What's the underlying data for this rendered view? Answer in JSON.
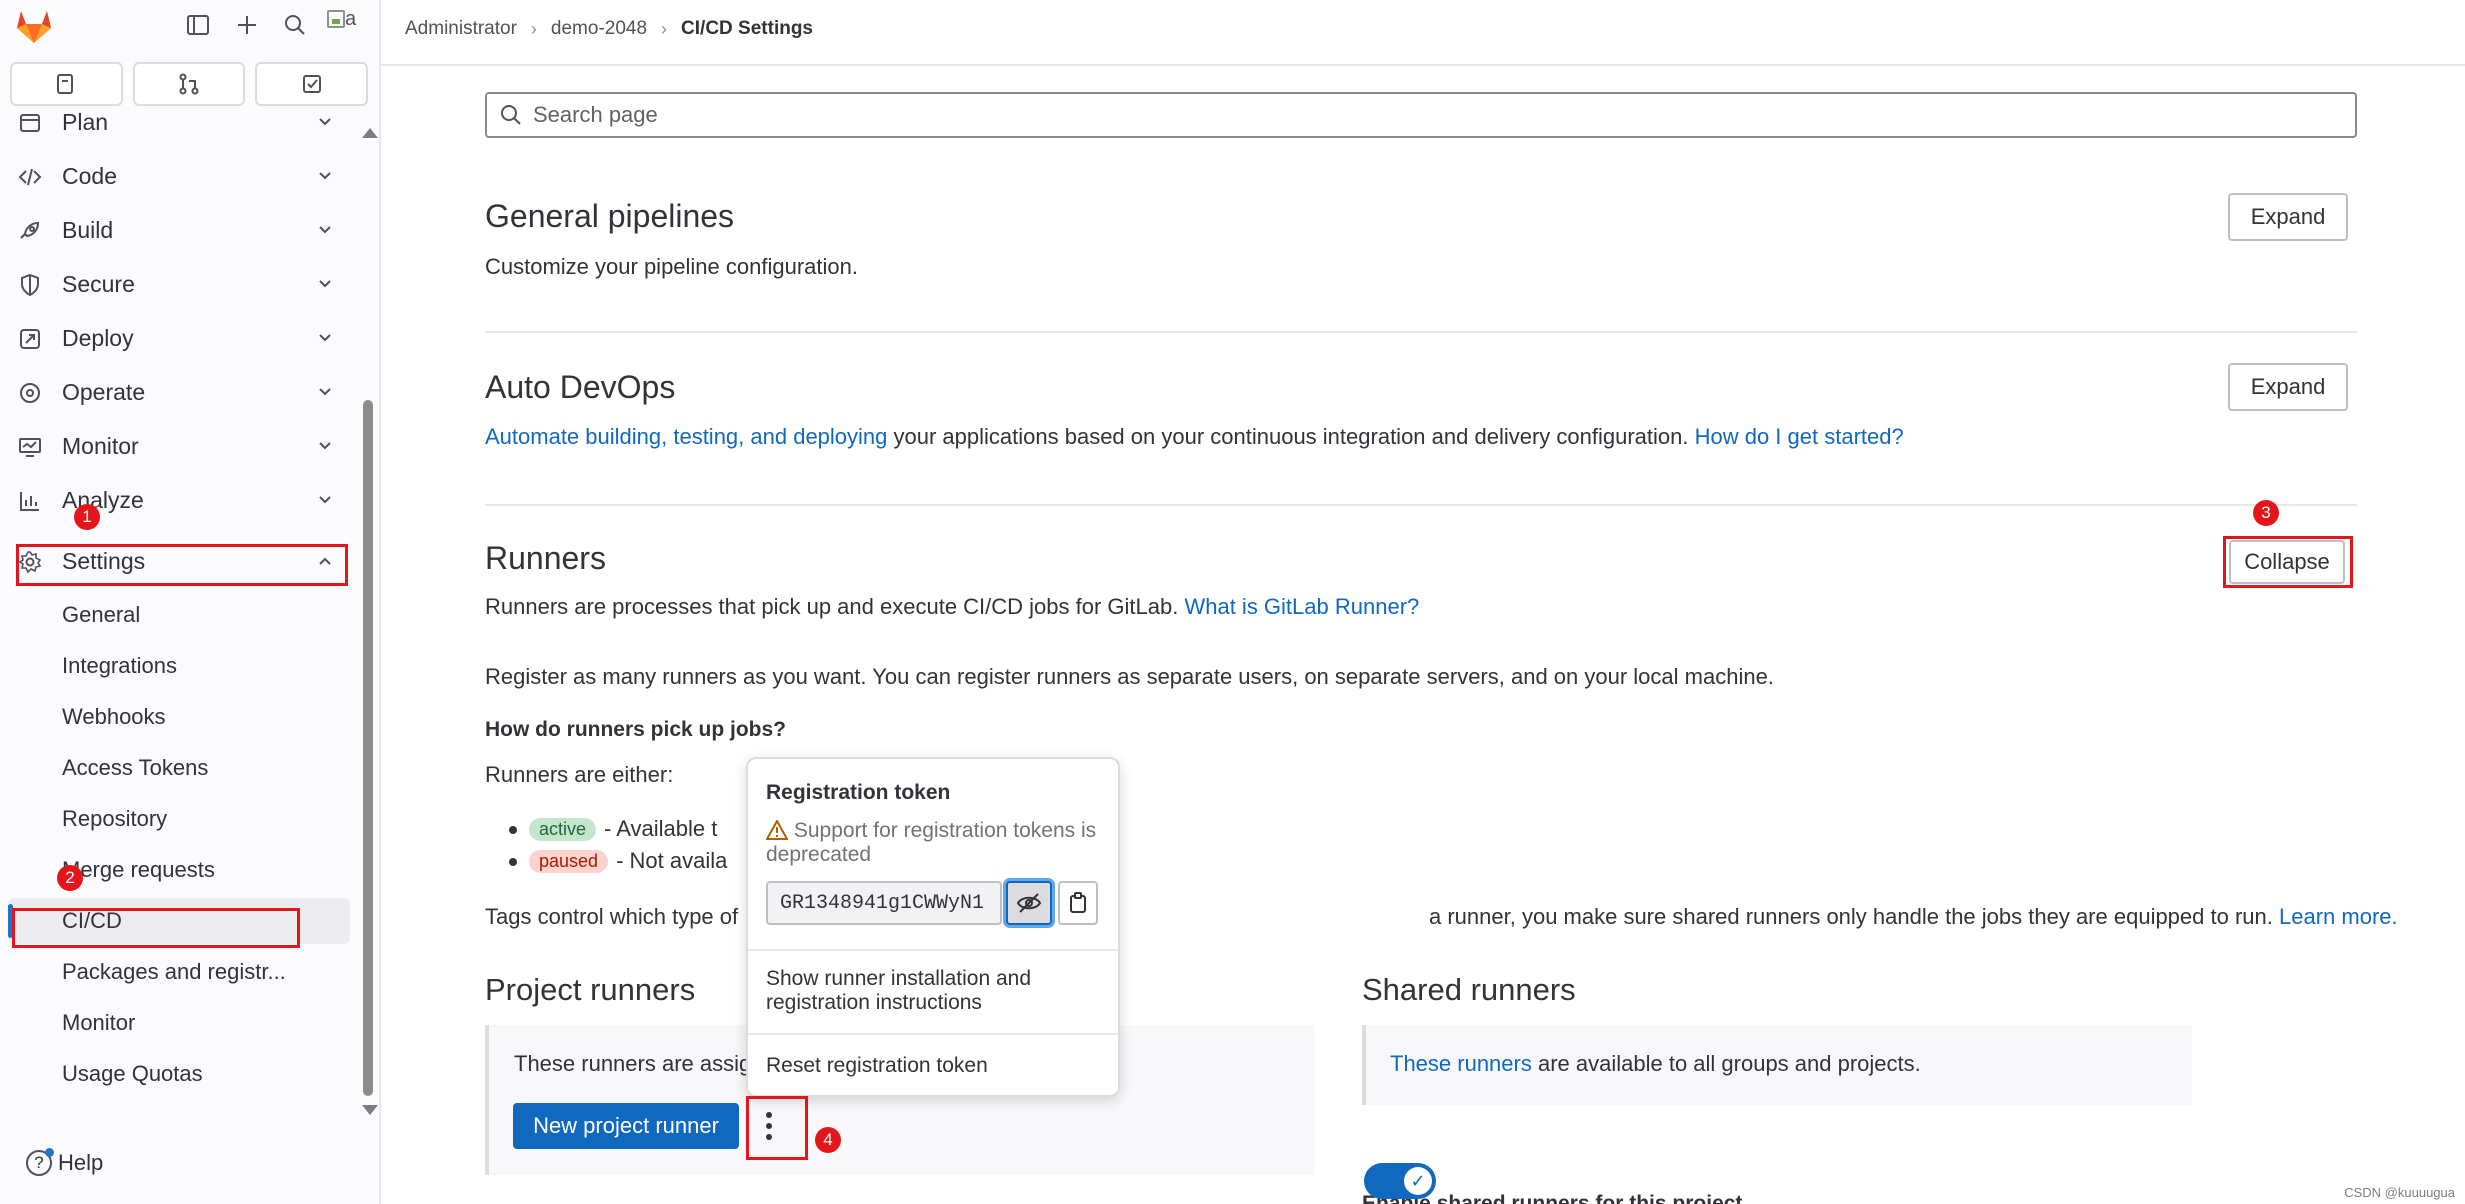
{
  "breadcrumb": {
    "items": [
      "Administrator",
      "demo-2048"
    ],
    "current": "CI/CD Settings"
  },
  "sidebar": {
    "avatar_alt": "a",
    "nav": [
      {
        "label": "Plan",
        "icon": "plan-icon"
      },
      {
        "label": "Code",
        "icon": "code-icon"
      },
      {
        "label": "Build",
        "icon": "rocket-icon"
      },
      {
        "label": "Secure",
        "icon": "shield-icon"
      },
      {
        "label": "Deploy",
        "icon": "deploy-icon"
      },
      {
        "label": "Operate",
        "icon": "operate-icon"
      },
      {
        "label": "Monitor",
        "icon": "monitor-icon"
      },
      {
        "label": "Analyze",
        "icon": "analyze-icon"
      },
      {
        "label": "Settings",
        "icon": "gear-icon"
      }
    ],
    "settings_items": [
      "General",
      "Integrations",
      "Webhooks",
      "Access Tokens",
      "Repository",
      "Merge requests",
      "CI/CD",
      "Packages and registr...",
      "Monitor",
      "Usage Quotas"
    ],
    "help_label": "Help"
  },
  "search": {
    "placeholder": "Search page"
  },
  "sections": {
    "general": {
      "title": "General pipelines",
      "desc": "Customize your pipeline configuration.",
      "button": "Expand"
    },
    "autodevops": {
      "title": "Auto DevOps",
      "link1": "Automate building, testing, and deploying",
      "text": " your applications based on your continuous integration and delivery configuration. ",
      "link2": "How do I get started?",
      "button": "Expand"
    },
    "runners": {
      "title": "Runners",
      "desc": "Runners are processes that pick up and execute CI/CD jobs for GitLab. ",
      "desc_link": "What is GitLab Runner?",
      "button": "Collapse",
      "register_text": "Register as many runners as you want. You can register runners as separate users, on separate servers, and on your local machine.",
      "how_title": "How do runners pick up jobs?",
      "either": "Runners are either:",
      "badge_active": "active",
      "active_text": "- Available t",
      "badge_paused": "paused",
      "paused_text": "- Not availa",
      "tags_text_start": "Tags control which type of",
      "tags_text_end": "a runner, you make sure shared runners only handle the jobs they are equipped to run. ",
      "tags_link": "Learn more."
    },
    "project_runners": {
      "title": "Project runners",
      "info": "These runners are assig",
      "new_button": "New project runner"
    },
    "shared_runners": {
      "title": "Shared runners",
      "info_link": "These runners",
      "info_text": " are available to all groups and projects.",
      "enable_label": "Enable shared runners for this project",
      "enabled": true
    }
  },
  "popover": {
    "title": "Registration token",
    "warning": "Support for registration tokens is deprecated",
    "token": "GR1348941g1CWWyN1",
    "item1": "Show runner installation and registration instructions",
    "item2": "Reset registration token"
  },
  "annotations": [
    "1",
    "2",
    "3",
    "4"
  ],
  "watermark": "CSDN @kuuuugua",
  "colors": {
    "link": "#1068bf",
    "primary": "#1068bf",
    "annotation": "#e5161b",
    "active_nav_bar": "#1f75cb"
  }
}
